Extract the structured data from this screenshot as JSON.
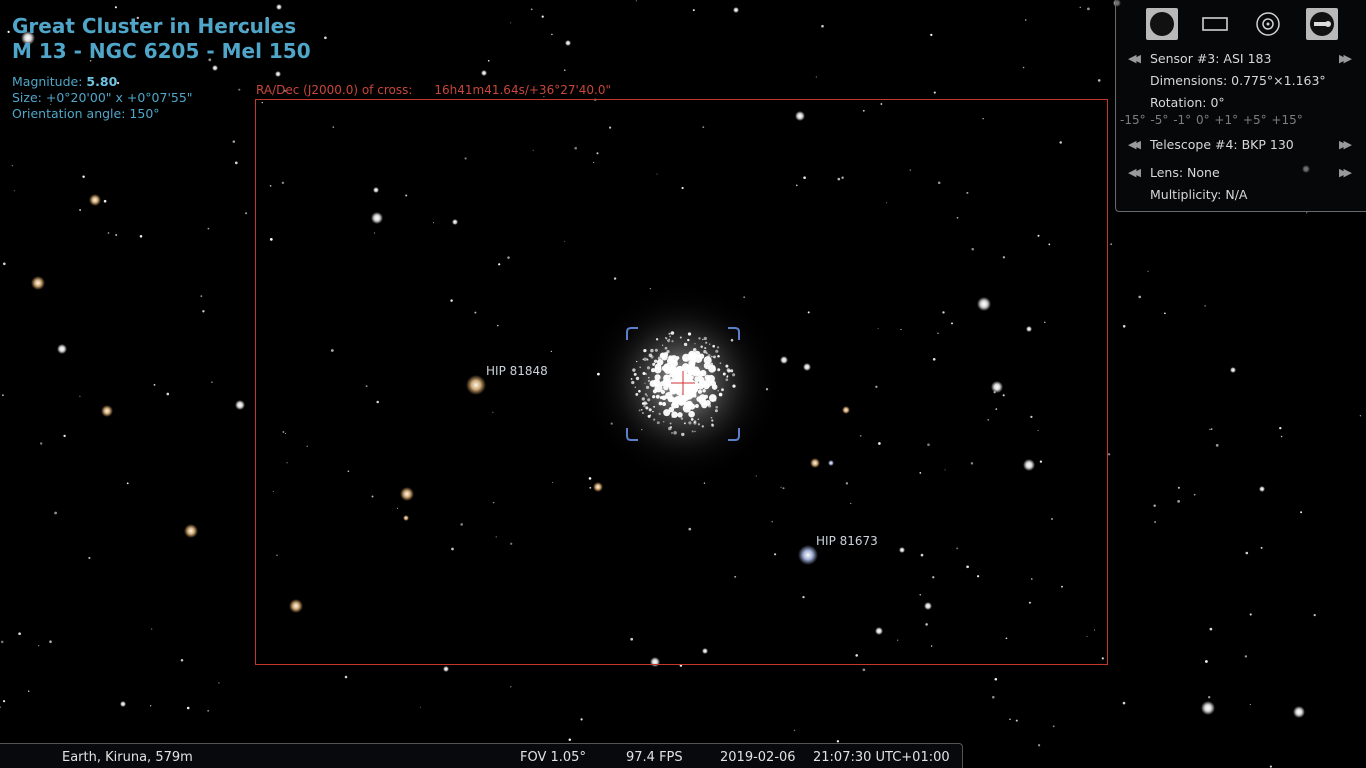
{
  "object": {
    "title_line1": "Great Cluster in Hercules",
    "title_line2": "M 13 - NGC 6205 - Mel 150",
    "magnitude_label": "Magnitude: ",
    "magnitude_value": "5.80",
    "size": "Size: +0°20'00\" x +0°07'55\"",
    "orientation": "Orientation angle: 150°"
  },
  "crosshair": {
    "radec_label": "RA/Dec (J2000.0) of cross:",
    "radec_value": "16h41m41.64s/+36°27'40.0\""
  },
  "star_labels": [
    "HIP 81848",
    "HIP 81673"
  ],
  "oculars_panel": {
    "tools": [
      "ccd-mode-icon",
      "sensor-frame-icon",
      "ocular-icon",
      "telrad-icon"
    ],
    "sensor": "Sensor #3: ASI 183",
    "dimensions": "Dimensions: 0.775°×1.163°",
    "rotation": "Rotation: 0°",
    "rotation_steps": "-15° -5° -1° 0° +1° +5° +15°",
    "telescope": "Telescope #4: BKP 130",
    "lens": "Lens: None",
    "multiplicity": "Multiplicity: N/A"
  },
  "bottom_bar": {
    "location": "Earth, Kiruna, 579m",
    "fov": "FOV 1.05°",
    "fps": "97.4 FPS",
    "date": "2019-02-06",
    "time": "21:07:30 UTC+01:00"
  },
  "colors": {
    "info_text": "#4fa6c9",
    "frame": "#c0392b",
    "crosshair_text": "#c8463a",
    "reticle": "#5b7fc9"
  }
}
